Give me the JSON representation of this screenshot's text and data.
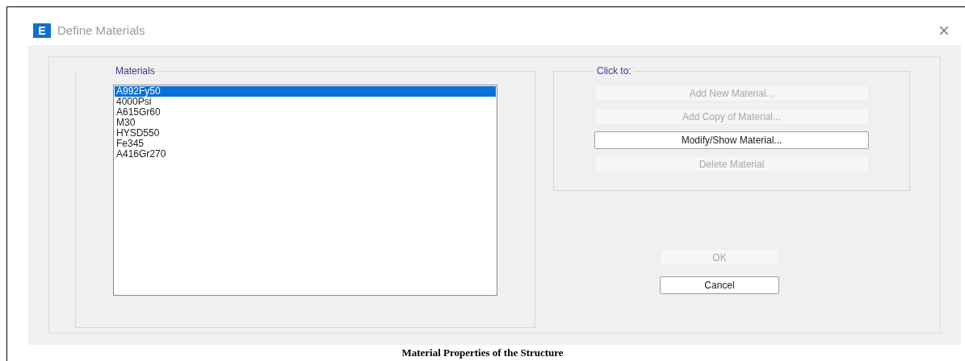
{
  "window": {
    "title": "Define Materials",
    "app_letter": "E",
    "close": "×"
  },
  "materials": {
    "label": "Materials",
    "items": [
      {
        "text": "A992Fy50",
        "selected": true
      },
      {
        "text": "4000Psi",
        "selected": false
      },
      {
        "text": "A615Gr60",
        "selected": false
      },
      {
        "text": "M30",
        "selected": false
      },
      {
        "text": "HYSD550",
        "selected": false
      },
      {
        "text": "Fe345",
        "selected": false
      },
      {
        "text": "A416Gr270",
        "selected": false
      }
    ]
  },
  "actions": {
    "label": "Click to:",
    "buttons": [
      {
        "label": "Add New Material...",
        "disabled": true
      },
      {
        "label": "Add Copy of Material...",
        "disabled": true
      },
      {
        "label": "Modify/Show Material...",
        "disabled": false
      },
      {
        "label": "Delete Material",
        "disabled": true
      }
    ]
  },
  "dialog_buttons": [
    {
      "label": "OK",
      "disabled": true
    },
    {
      "label": "Cancel",
      "disabled": false
    }
  ],
  "caption": "Material Properties of the Structure"
}
